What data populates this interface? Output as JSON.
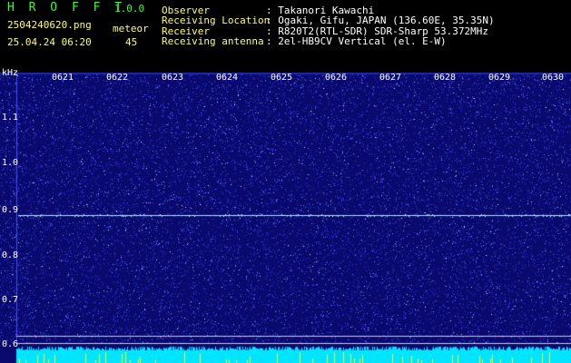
{
  "header": {
    "app_name": "H R O F F T",
    "version": "1.0.0",
    "filename": "2504240620.png",
    "mode": "meteor",
    "datetime": "25.04.24 06:20",
    "count": "45",
    "info_labels": [
      "Observer",
      "Receiving Location",
      "Receiver",
      "Receiving antenna"
    ],
    "info_values": [
      ": Takanori Kawachi",
      ": Ogaki, Gifu, JAPAN (136.60E, 35.35N)",
      ": R820T2(RTL-SDR) SDR-Sharp 53.372MHz",
      ": 2el-HB9CV Vertical (el. E-W)"
    ]
  },
  "plot": {
    "y_unit": "kHz",
    "y_ticks": [
      "1.1",
      "1.0",
      "0.9",
      "0.8",
      "0.7",
      "0.6"
    ],
    "x_ticks": [
      "0621",
      "0622",
      "0623",
      "0624",
      "0625",
      "0626",
      "0627",
      "0628",
      "0629",
      "0630"
    ],
    "colors": {
      "background": "#0a0a6e",
      "noise": "#5a6cff",
      "signal": "#7fffd4",
      "floor": "#00e5ff",
      "spike": "#ffff00"
    }
  }
}
